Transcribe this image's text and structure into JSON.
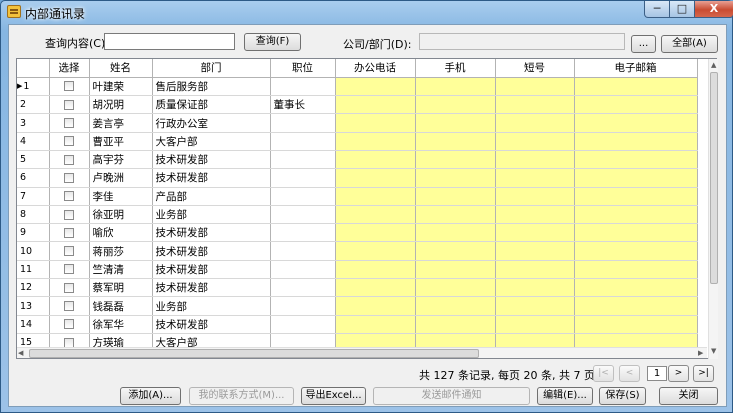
{
  "window": {
    "title": "内部通讯录",
    "min_label": "─",
    "max_label": "□",
    "close_label": "X"
  },
  "search": {
    "query_label": "查询内容(C)",
    "query_value": "",
    "query_button": "查询(F)",
    "company_label": "公司/部门(D):",
    "company_value": "",
    "browse_button": "...",
    "all_button": "全部(A)"
  },
  "grid": {
    "columns": [
      "",
      "选择",
      "姓名",
      "部门",
      "职位",
      "办公电话",
      "手机",
      "短号",
      "电子邮箱"
    ],
    "rows": [
      {
        "no": "1",
        "name": "叶建荣",
        "dept": "售后服务部",
        "position": ""
      },
      {
        "no": "2",
        "name": "胡况明",
        "dept": "质量保证部",
        "position": "董事长"
      },
      {
        "no": "3",
        "name": "姜言亭",
        "dept": "行政办公室",
        "position": ""
      },
      {
        "no": "4",
        "name": "曹亚平",
        "dept": "大客户部",
        "position": ""
      },
      {
        "no": "5",
        "name": "高宇芬",
        "dept": "技术研发部",
        "position": ""
      },
      {
        "no": "6",
        "name": "卢晚洲",
        "dept": "技术研发部",
        "position": ""
      },
      {
        "no": "7",
        "name": "李佳",
        "dept": "产品部",
        "position": ""
      },
      {
        "no": "8",
        "name": "徐亚明",
        "dept": "业务部",
        "position": ""
      },
      {
        "no": "9",
        "name": "喻欣",
        "dept": "技术研发部",
        "position": ""
      },
      {
        "no": "10",
        "name": "蒋丽莎",
        "dept": "技术研发部",
        "position": ""
      },
      {
        "no": "11",
        "name": "竺清清",
        "dept": "技术研发部",
        "position": ""
      },
      {
        "no": "12",
        "name": "蔡军明",
        "dept": "技术研发部",
        "position": ""
      },
      {
        "no": "13",
        "name": "钱磊磊",
        "dept": "业务部",
        "position": ""
      },
      {
        "no": "14",
        "name": "徐军华",
        "dept": "技术研发部",
        "position": ""
      },
      {
        "no": "15",
        "name": "方瑛瑜",
        "dept": "大客户部",
        "position": ""
      }
    ],
    "current_row": 1,
    "editable_color": "#ffff99"
  },
  "pager": {
    "summary": "共 127 条记录, 每页 20 条, 共 7 页",
    "first": "|<",
    "prev": "<",
    "page": "1",
    "next": ">",
    "last": ">|"
  },
  "actions": {
    "add": "添加(A)...",
    "my_contact": "我的联系方式(M)...",
    "export": "导出Excel...",
    "send_mail": "发送邮件通知",
    "edit": "编辑(E)...",
    "save": "保存(S)",
    "close": "关闭"
  }
}
